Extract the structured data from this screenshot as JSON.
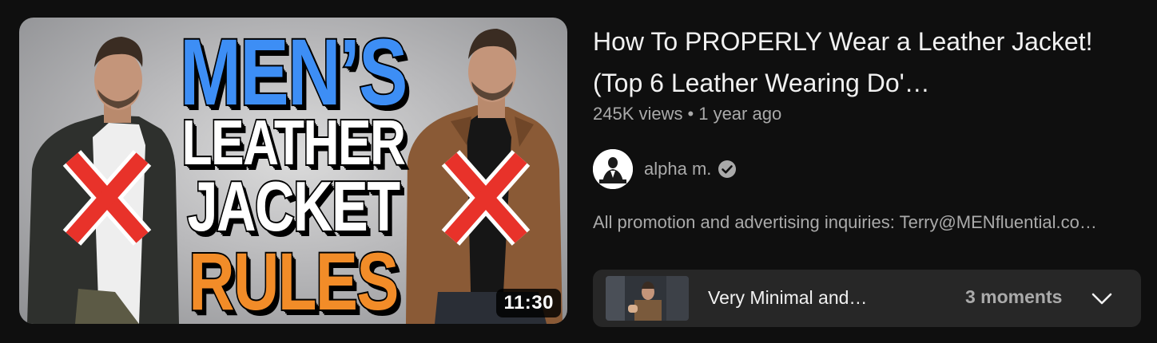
{
  "video": {
    "thumbnail_text": {
      "line1": "MEN’S",
      "line2": "LEATHER",
      "line3": "JACKET",
      "line4": "RULES",
      "line1_color": "#3d8ef5",
      "line2_color": "#ffffff",
      "line3_color": "#ffffff",
      "line4_color": "#f28c28",
      "x_mark_color": "#e8322a"
    },
    "duration": "11:30",
    "title": "How To PROPERLY Wear a Leather Jacket! (Top 6 Leather Wearing Do'…",
    "views": "245K views",
    "separator": "•",
    "age": "1 year ago",
    "channel": {
      "name": "alpha m.",
      "avatar_icon": "channel-avatar-icon",
      "verified_icon": "verified-check-icon"
    },
    "description": "All promotion and advertising inquiries: Terry@MENfluential.co…"
  },
  "chapters": {
    "title": "Very Minimal and…",
    "count": "3 moments",
    "expand_icon": "chevron-down-icon"
  },
  "colors": {
    "background": "#0f0f0f",
    "primary_text": "#f1f1f1",
    "secondary_text": "#aaaaaa",
    "chapters_bg": "#272727"
  }
}
